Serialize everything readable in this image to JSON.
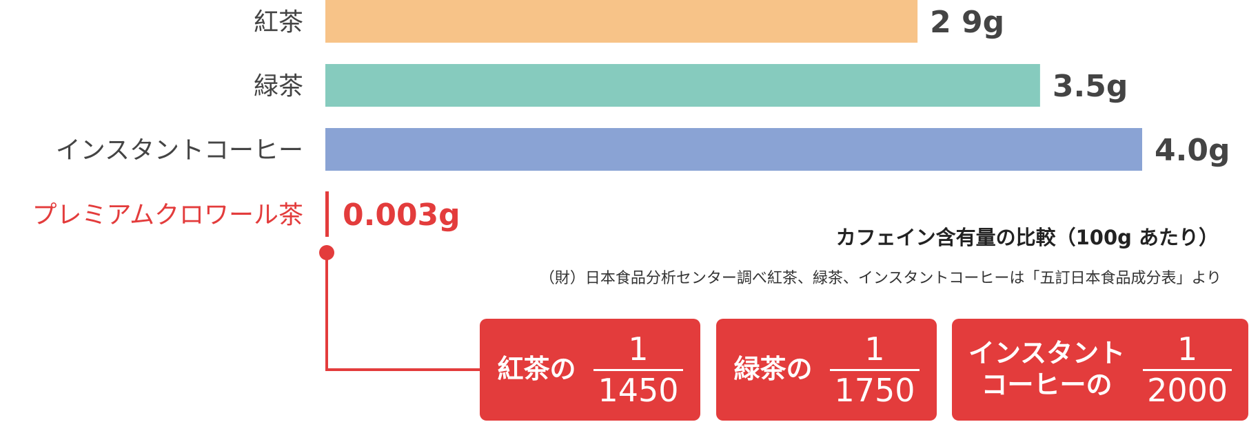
{
  "chart_data": {
    "type": "bar",
    "orientation": "horizontal",
    "categories": [
      "紅茶",
      "緑茶",
      "インスタントコーヒー",
      "プレミアムクロワール茶"
    ],
    "values": [
      2.9,
      3.5,
      4.0,
      0.003
    ],
    "value_labels": [
      "2 9g",
      "3.5g",
      "4.0g",
      "0.003g"
    ],
    "unit": "g",
    "xlim": [
      0,
      4.0
    ],
    "grid": false,
    "legend": "none"
  },
  "colors": {
    "bars": [
      "#f7c388",
      "#86cbbe",
      "#8aa3d4",
      "#e33c3c"
    ],
    "accent": "#e33c3c",
    "text": "#444444"
  },
  "caption": {
    "title": "カフェイン含有量の比較（100g あたり）",
    "source": "（財）日本食品分析センター調べ紅茶、緑茶、インスタントコーヒーは「五訂日本食品成分表」より"
  },
  "ratios": [
    {
      "name_lines": [
        "紅茶の"
      ],
      "numerator": "1",
      "denominator": "1450"
    },
    {
      "name_lines": [
        "緑茶の"
      ],
      "numerator": "1",
      "denominator": "1750"
    },
    {
      "name_lines": [
        "インスタント",
        "コーヒーの"
      ],
      "numerator": "1",
      "denominator": "2000"
    }
  ]
}
